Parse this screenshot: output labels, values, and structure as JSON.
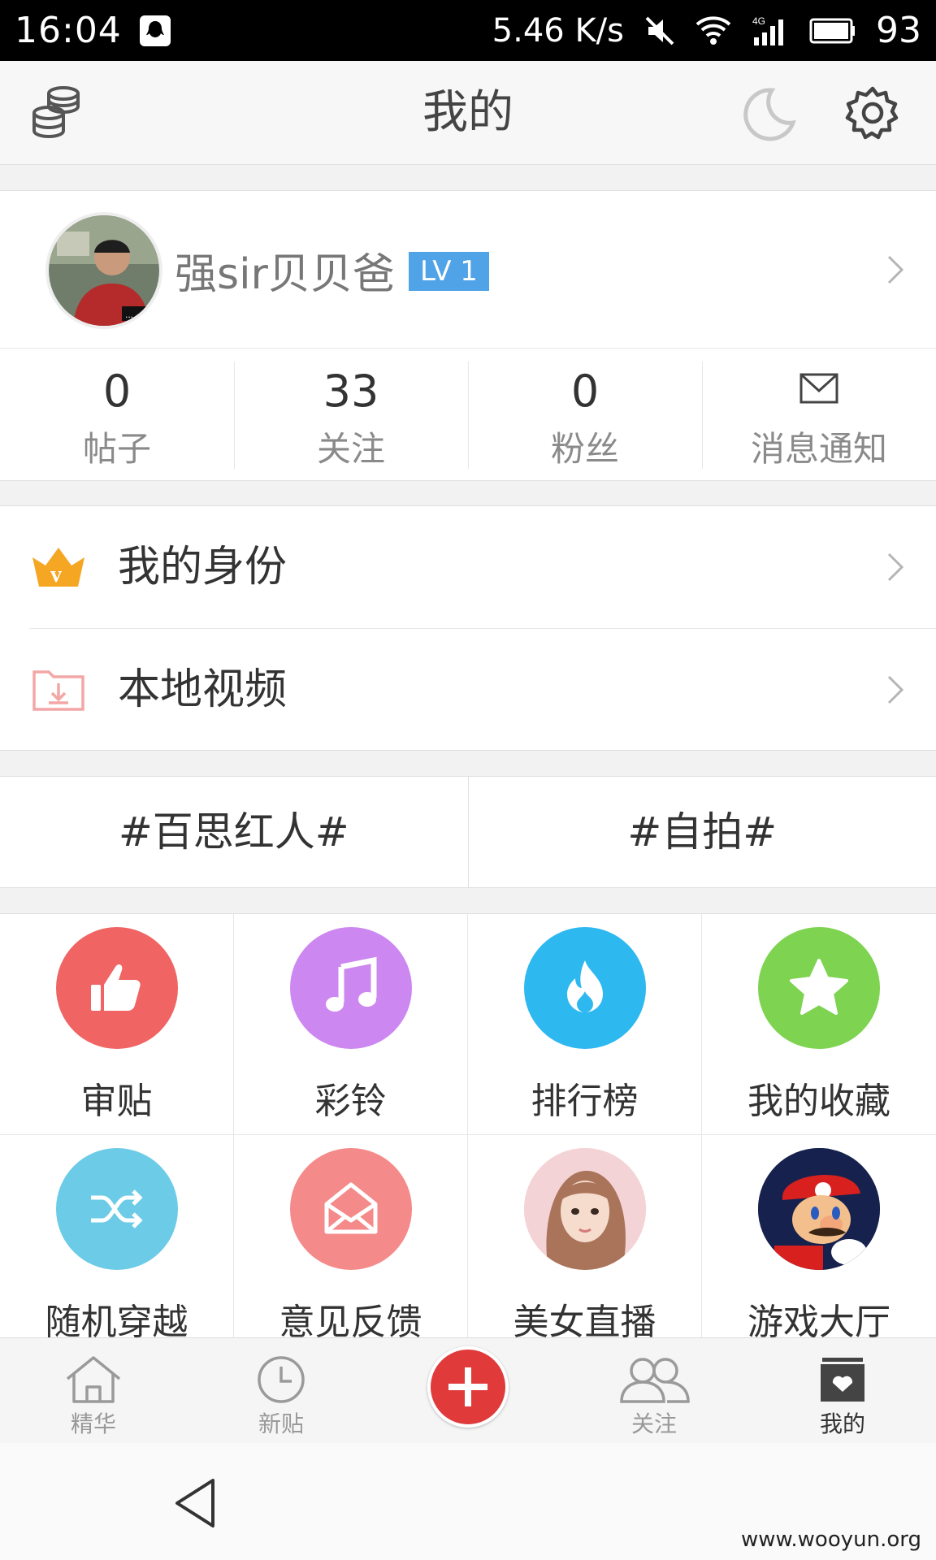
{
  "status_bar": {
    "time": "16:04",
    "net_speed": "5.46 K/s",
    "battery": "93",
    "icons": [
      "qq-icon",
      "mute-icon",
      "wifi-icon",
      "signal-4g-icon",
      "battery-icon"
    ]
  },
  "header": {
    "title": "我的",
    "left_icon": "coins-icon",
    "right_icons": [
      "night-mode-moon-icon",
      "settings-gear-icon"
    ]
  },
  "profile": {
    "username": "强sir贝贝爸",
    "level": "LV 1"
  },
  "stats": [
    {
      "value": "0",
      "label": "帖子"
    },
    {
      "value": "33",
      "label": "关注"
    },
    {
      "value": "0",
      "label": "粉丝"
    },
    {
      "label": "消息通知",
      "icon": "mail-icon"
    }
  ],
  "menu": [
    {
      "label": "我的身份",
      "icon": "crown-v-icon",
      "color": "#f5a623"
    },
    {
      "label": "本地视频",
      "icon": "folder-download-icon",
      "color": "#f3a6a6"
    }
  ],
  "tags": [
    "#百思红人#",
    "#自拍#"
  ],
  "grid": [
    {
      "label": "审贴",
      "icon": "thumbs-up-icon",
      "color": "#f06464"
    },
    {
      "label": "彩铃",
      "icon": "music-note-icon",
      "color": "#cc88f0"
    },
    {
      "label": "排行榜",
      "icon": "flame-icon",
      "color": "#2eb8f0"
    },
    {
      "label": "我的收藏",
      "icon": "star-icon",
      "color": "#7ed350"
    },
    {
      "label": "随机穿越",
      "icon": "shuffle-icon",
      "color": "#6ccbe6"
    },
    {
      "label": "意见反馈",
      "icon": "envelope-icon",
      "color": "#f48a8a"
    },
    {
      "label": "美女直播",
      "icon": "live-avatar-photo",
      "color": "#f3c9c9"
    },
    {
      "label": "游戏大厅",
      "icon": "game-mario-photo",
      "color": "#1d2a5a"
    }
  ],
  "bottom_nav": [
    {
      "label": "精华",
      "icon": "home-icon"
    },
    {
      "label": "新贴",
      "icon": "clock-icon"
    },
    {
      "label": "",
      "icon": "plus-icon"
    },
    {
      "label": "关注",
      "icon": "people-icon"
    },
    {
      "label": "我的",
      "icon": "profile-box-icon",
      "active": true
    }
  ],
  "system_nav": {
    "back_icon": "back-triangle-icon"
  },
  "watermark": "www.wooyun.org"
}
